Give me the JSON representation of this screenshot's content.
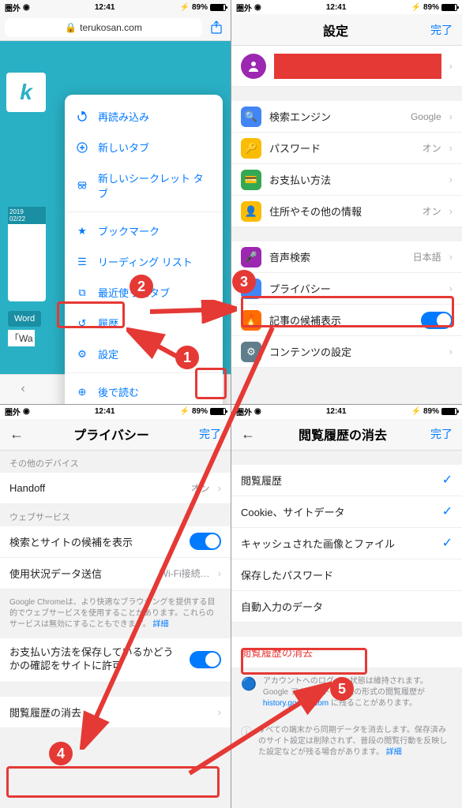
{
  "status": {
    "carrier": "圏外",
    "time": "12:41",
    "battery": "89%"
  },
  "screen1": {
    "url_host": "terukosan.com",
    "logo_letter": "k",
    "card_date": "2019\n02/22",
    "word_btn": "Word",
    "war_text": "「Wa",
    "popup": [
      {
        "label": "再読み込み",
        "icon": "reload"
      },
      {
        "label": "新しいタブ",
        "icon": "plus"
      },
      {
        "label": "新しいシークレット タブ",
        "icon": "incognito"
      },
      {
        "label": "ブックマーク",
        "icon": "star"
      },
      {
        "label": "リーディング リスト",
        "icon": "readlist"
      },
      {
        "label": "最近使ったタブ",
        "icon": "recent"
      },
      {
        "label": "履歴",
        "icon": "history"
      },
      {
        "label": "設定",
        "icon": "gear"
      },
      {
        "label": "後で読む",
        "icon": "later"
      }
    ]
  },
  "screen2": {
    "title": "設定",
    "done": "完了",
    "rows": [
      {
        "label": "検索エンジン",
        "value": "Google",
        "icon_bg": "#4285f4",
        "icon": "search"
      },
      {
        "label": "パスワード",
        "value": "オン",
        "icon_bg": "#fbbc04",
        "icon": "key"
      },
      {
        "label": "お支払い方法",
        "value": "",
        "icon_bg": "#34a853",
        "icon": "card"
      },
      {
        "label": "住所やその他の情報",
        "value": "オン",
        "icon_bg": "#fbbc04",
        "icon": "user"
      },
      {
        "label": "音声検索",
        "value": "日本語",
        "icon_bg": "#9c27b0",
        "icon": "mic"
      },
      {
        "label": "プライバシー",
        "value": "",
        "icon_bg": "#4285f4",
        "icon": "shield"
      },
      {
        "label": "記事の候補表示",
        "value": "",
        "icon_bg": "#ff6d00",
        "icon": "flame",
        "toggle": true
      },
      {
        "label": "コンテンツの設定",
        "value": "",
        "icon_bg": "#607d8b",
        "icon": "gear"
      }
    ]
  },
  "screen3": {
    "title": "プライバシー",
    "done": "完了",
    "section_other": "その他のデバイス",
    "handoff": {
      "label": "Handoff",
      "value": "オン"
    },
    "section_web": "ウェブサービス",
    "row_suggest": "検索とサイトの候補を表示",
    "row_usage": {
      "label": "使用状況データ送信",
      "value": "Wi-Fi接続…"
    },
    "note1": "Google Chromeは、より快適なブラウジングを提供する目的でウェブサービスを使用することがあります。これらのサービスは無効にすることもできます。",
    "note1_link": "詳細",
    "row_payment": "お支払い方法を保存しているかどうかの確認をサイトに許可",
    "row_clear": "閲覧履歴の消去"
  },
  "screen4": {
    "title": "閲覧履歴の消去",
    "done": "完了",
    "items": [
      {
        "label": "閲覧履歴",
        "checked": true
      },
      {
        "label": "Cookie、サイトデータ",
        "checked": true
      },
      {
        "label": "キャッシュされた画像とファイル",
        "checked": true
      },
      {
        "label": "保存したパスワード",
        "checked": false
      },
      {
        "label": "自動入力のデータ",
        "checked": false
      }
    ],
    "clear_btn": "閲覧履歴の消去",
    "note2a": "アカウントへのログイン状態は維持されます。Google アカウントでの他の形式の閲覧履歴が ",
    "note2_link": "history.google.com",
    "note2b": " に残ることがあります。",
    "note3": "すべての端末から同期データを消去します。保存済みのサイト設定は削除されず、普段の閲覧行動を反映した設定などが残る場合があります。",
    "note3_link": "詳細"
  },
  "annotations": {
    "b1": "1",
    "b2": "2",
    "b3": "3",
    "b4": "4",
    "b5": "5"
  }
}
